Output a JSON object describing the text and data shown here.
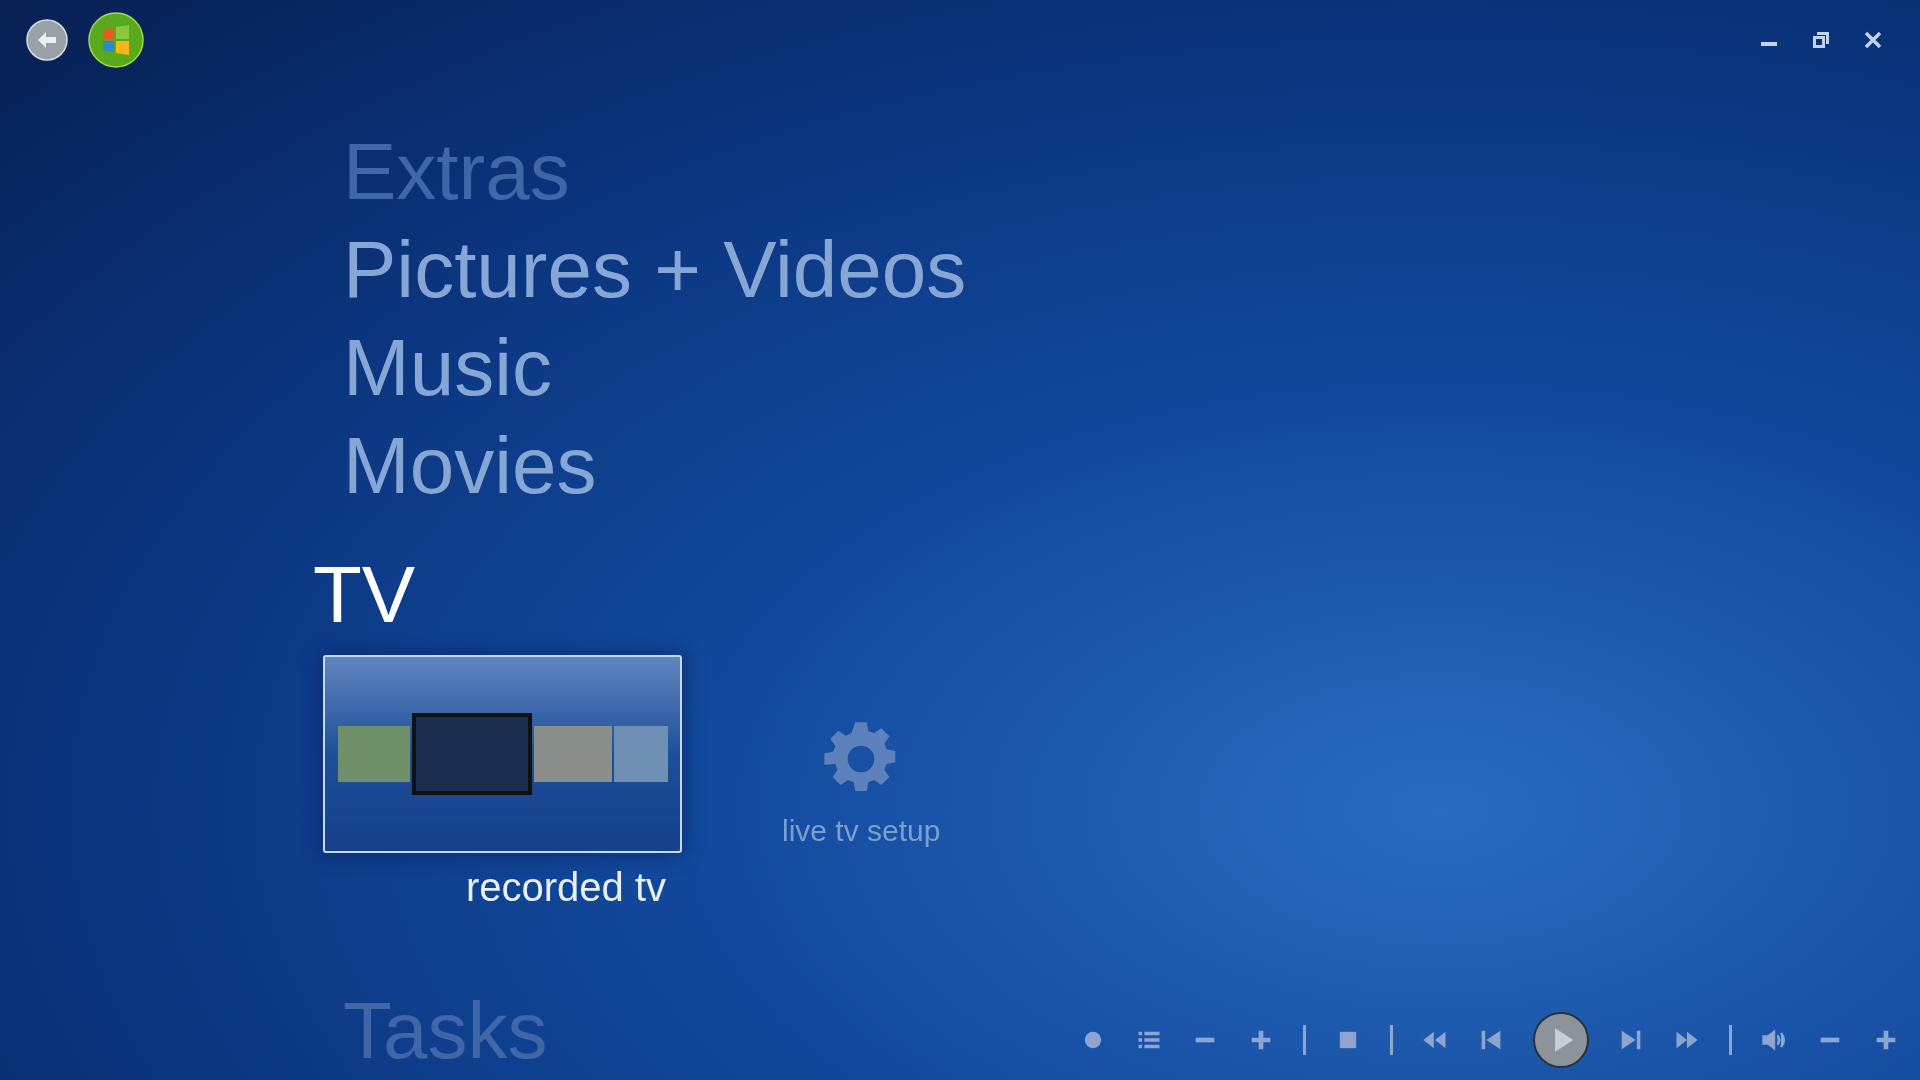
{
  "menu": [
    {
      "label": "Extras",
      "faded": true
    },
    {
      "label": "Pictures + Videos",
      "faded": false
    },
    {
      "label": "Music",
      "faded": false
    },
    {
      "label": "Movies",
      "faded": false
    }
  ],
  "current": {
    "label": "TV",
    "tiles": [
      {
        "kind": "preview",
        "label": "recorded tv",
        "selected": true
      },
      {
        "kind": "setup",
        "label": "live tv setup",
        "selected": false
      }
    ]
  },
  "below": [
    {
      "label": "Tasks",
      "faded": true
    }
  ]
}
